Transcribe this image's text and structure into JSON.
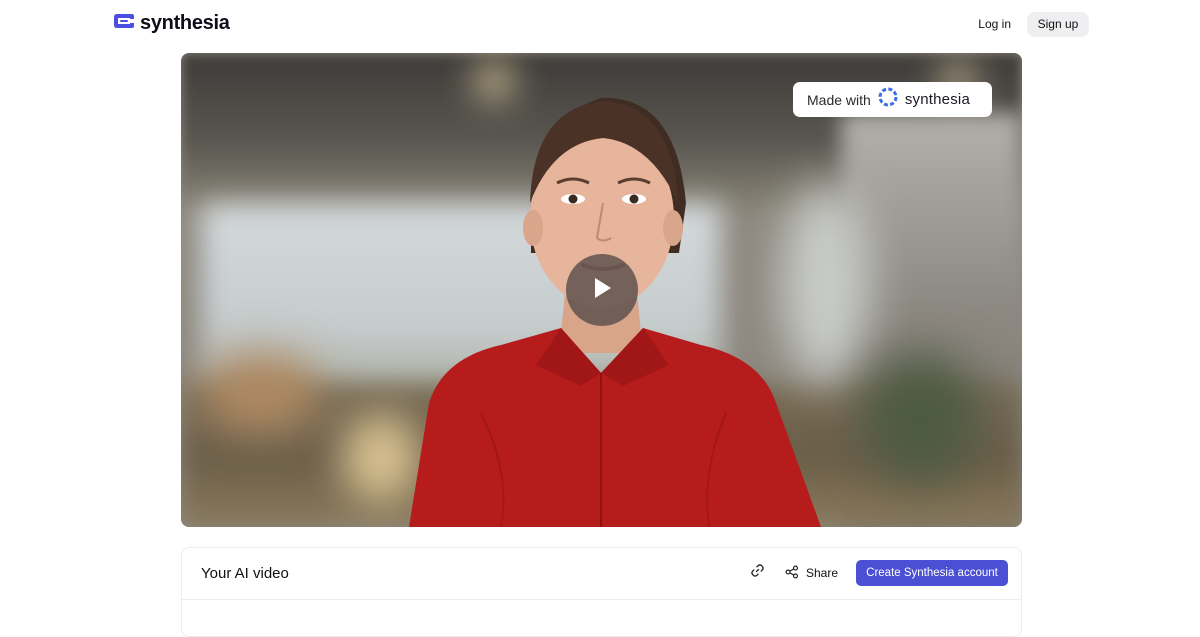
{
  "header": {
    "brand_name": "synthesia",
    "login_label": "Log in",
    "signup_label": "Sign up"
  },
  "video": {
    "badge_prefix": "Made with",
    "badge_brand": "synthesia"
  },
  "info": {
    "title": "Your AI video",
    "share_label": "Share",
    "create_account_label": "Create Synthesia account"
  },
  "colors": {
    "accent": "#4a4fd3",
    "brand_logo": "#4b4fe0",
    "shirt_red": "#b71c1c"
  },
  "icons": {
    "logo": "synthesia-logo-icon",
    "badge_logo": "synthesia-badge-icon",
    "play": "play-icon",
    "link": "link-icon",
    "share": "share-icon"
  }
}
